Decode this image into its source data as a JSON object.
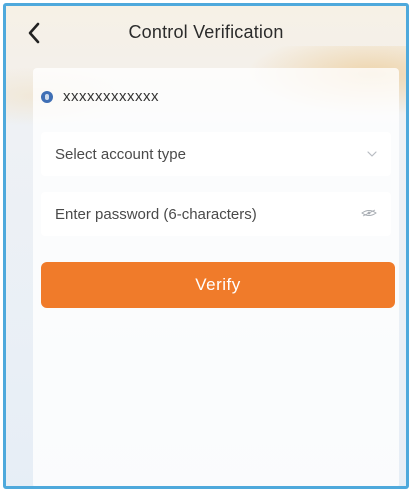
{
  "header": {
    "title": "Control Verification",
    "back_icon": "chevron-left-icon"
  },
  "account": {
    "icon": "account-dot-icon",
    "masked_number": "xxxxxxxxxxxx"
  },
  "form": {
    "account_type_placeholder": "Select account type",
    "password_placeholder": "Enter password (6-characters)",
    "password_toggle_icon": "eye-icon",
    "account_type_icon": "chevron-down-icon"
  },
  "actions": {
    "verify_label": "Verify"
  },
  "colors": {
    "frame_border": "#4ea9dc",
    "primary_button": "#f07b2a",
    "account_icon": "#3f6fb5"
  }
}
